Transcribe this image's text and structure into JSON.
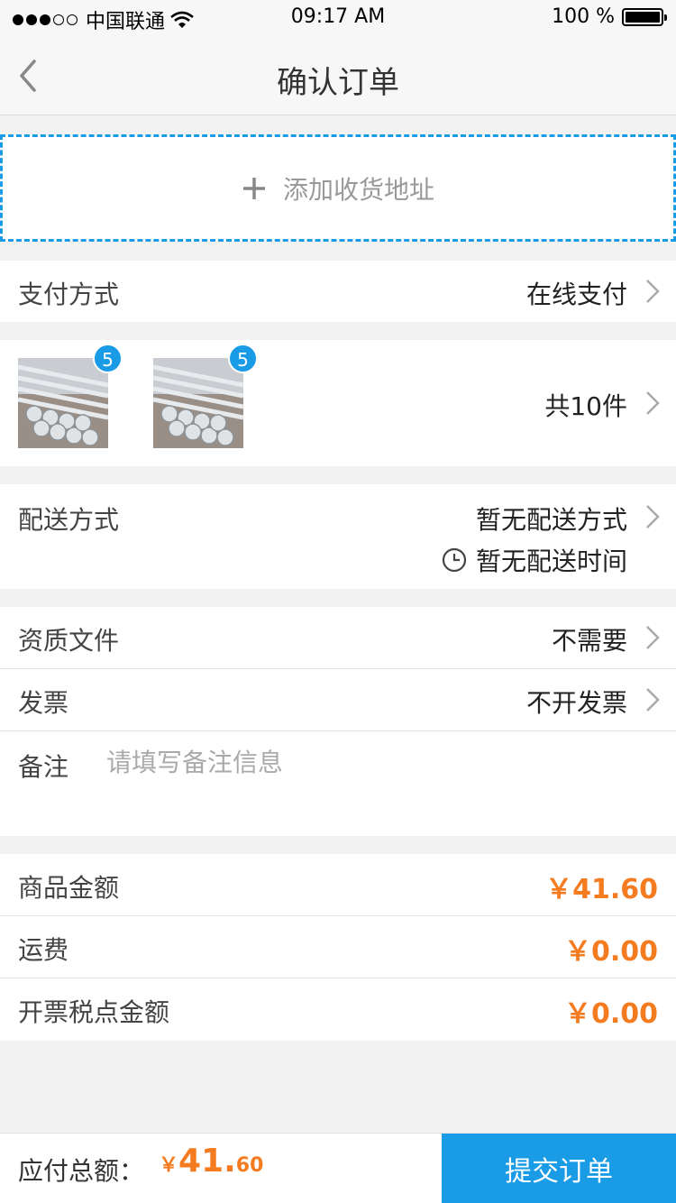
{
  "status_bar": {
    "carrier": "中国联通",
    "time": "09:17 AM",
    "battery": "100 %"
  },
  "header": {
    "title": "确认订单"
  },
  "address": {
    "add_label": "添加收货地址"
  },
  "payment": {
    "label": "支付方式",
    "value": "在线支付"
  },
  "goods": {
    "items": [
      {
        "badge": "5"
      },
      {
        "badge": "5"
      }
    ],
    "count_text": "共10件"
  },
  "delivery": {
    "label": "配送方式",
    "method": "暂无配送方式",
    "time": "暂无配送时间"
  },
  "documents": {
    "label": "资质文件",
    "value": "不需要"
  },
  "invoice": {
    "label": "发票",
    "value": "不开发票"
  },
  "remark": {
    "label": "备注",
    "placeholder": "请填写备注信息"
  },
  "amounts": {
    "goods_label": "商品金额",
    "goods_value": "￥41.60",
    "freight_label": "运费",
    "freight_value": "￥0.00",
    "tax_label": "开票税点金额",
    "tax_value": "￥0.00"
  },
  "footer": {
    "total_label": "应付总额：",
    "total_currency": "￥",
    "total_int": "41.",
    "total_dec": "60",
    "submit_label": "提交订单"
  },
  "colors": {
    "accent": "#1a9be6",
    "price": "#f47b20"
  }
}
